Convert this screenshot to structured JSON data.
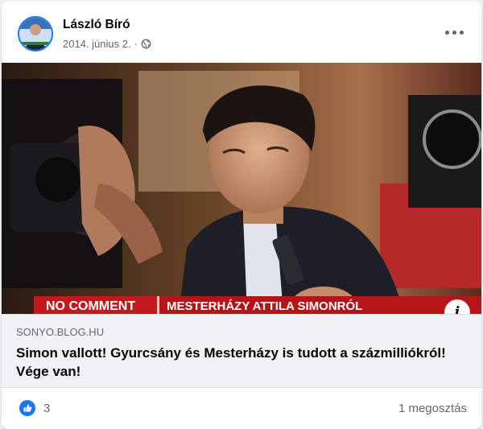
{
  "post": {
    "author": "László Bíró",
    "date": "2014. június 2.",
    "date_separator": "·",
    "audience_icon": "globe-icon",
    "more_icon": "more-options-icon"
  },
  "media": {
    "lower_third_left": "NO COMMENT",
    "lower_third_right": "MESTERHÁZY ATTILA SIMONRÓL",
    "info_label": "i"
  },
  "link": {
    "domain": "SONYO.BLOG.HU",
    "headline": "Simon vallott! Gyurcsány és Mesterházy is tudott a százmilliókról! Vége van!"
  },
  "footer": {
    "reaction_icon": "like-icon",
    "like_count": "3",
    "shares": "1 megosztás"
  },
  "colors": {
    "accent": "#1877f2",
    "lower_third": "#c3181d"
  }
}
